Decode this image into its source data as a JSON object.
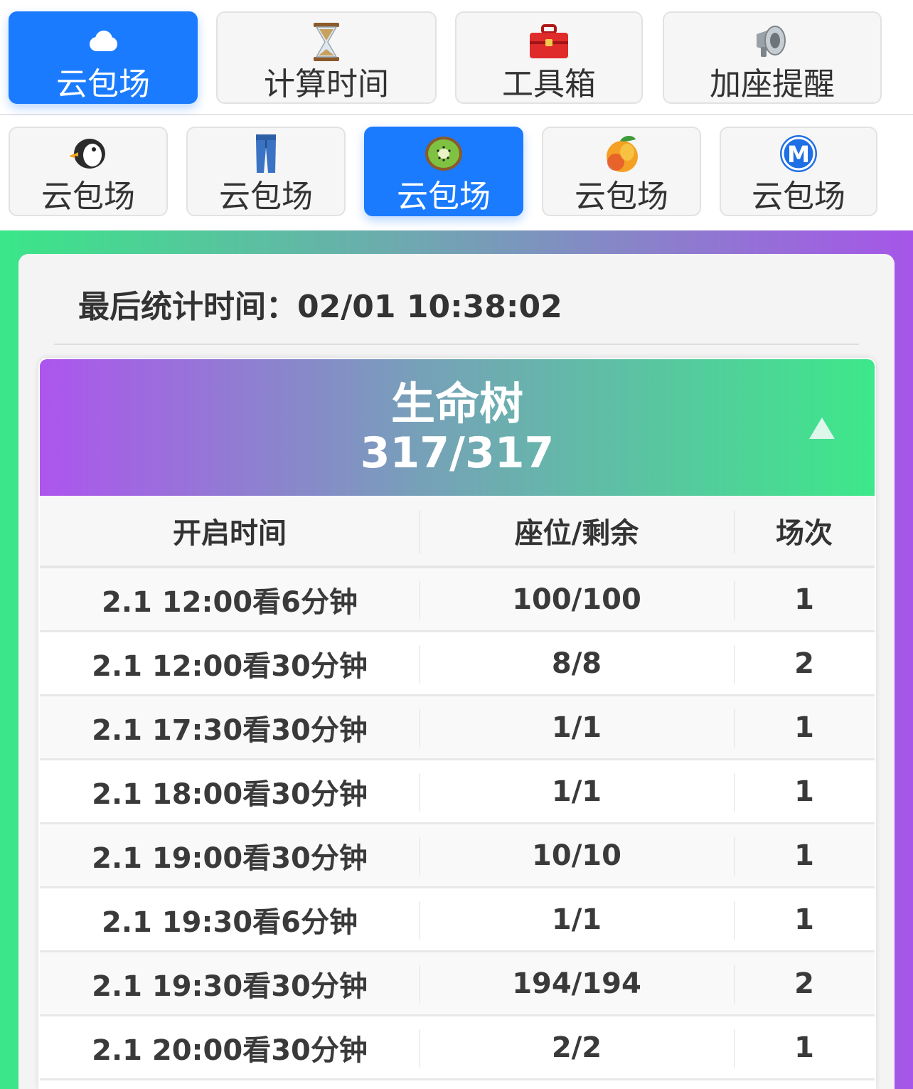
{
  "top_tabs": [
    {
      "label": "云包场",
      "icon": "cloud-icon",
      "active": true
    },
    {
      "label": "计算时间",
      "icon": "hourglass-icon",
      "active": false
    },
    {
      "label": "工具箱",
      "icon": "toolbox-icon",
      "active": false
    },
    {
      "label": "加座提醒",
      "icon": "megaphone-icon",
      "active": false
    }
  ],
  "sub_tabs": [
    {
      "label": "云包场",
      "icon": "penguin-icon",
      "active": false
    },
    {
      "label": "云包场",
      "icon": "jeans-icon",
      "active": false
    },
    {
      "label": "云包场",
      "icon": "kiwi-icon",
      "active": true
    },
    {
      "label": "云包场",
      "icon": "mango-icon",
      "active": false
    },
    {
      "label": "云包场",
      "icon": "metro-m-icon",
      "active": false
    }
  ],
  "stat": {
    "text": "最后统计时间：02/01 10:38:02"
  },
  "panel": {
    "title": "生命树",
    "count": "317/317"
  },
  "table": {
    "headers": [
      "开启时间",
      "座位/剩余",
      "场次"
    ],
    "rows": [
      [
        "2.1 12:00看6分钟",
        "100/100",
        "1"
      ],
      [
        "2.1 12:00看30分钟",
        "8/8",
        "2"
      ],
      [
        "2.1 17:30看30分钟",
        "1/1",
        "1"
      ],
      [
        "2.1 18:00看30分钟",
        "1/1",
        "1"
      ],
      [
        "2.1 19:00看30分钟",
        "10/10",
        "1"
      ],
      [
        "2.1 19:30看6分钟",
        "1/1",
        "1"
      ],
      [
        "2.1 19:30看30分钟",
        "194/194",
        "2"
      ],
      [
        "2.1 20:00看30分钟",
        "2/2",
        "1"
      ]
    ]
  },
  "colors": {
    "accent": "#1a7bff",
    "gradient_green": "#3ae688",
    "gradient_purple": "#a656e8"
  }
}
